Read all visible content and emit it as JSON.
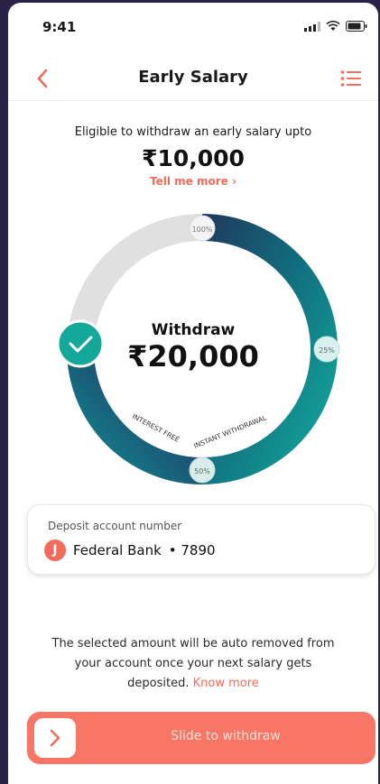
{
  "status_bar": {
    "time": "9:41"
  },
  "header": {
    "title": "Early Salary"
  },
  "eligibility": {
    "text": "Eligible to withdraw an early salary upto",
    "amount": "₹10,000",
    "link": "Tell me more ›"
  },
  "dial": {
    "label_top": "100%",
    "label_right": "25%",
    "label_bottom": "50%",
    "tag_left": "INTEREST FREE",
    "tag_right": "INSTANT WITHDRAWAL",
    "center_label": "Withdraw",
    "center_amount": "₹20,000"
  },
  "deposit": {
    "label": "Deposit account number",
    "bank_logo_letter": "J",
    "bank_name": "Federal Bank",
    "account": "• 7890"
  },
  "notice": {
    "text": "The selected amount will be auto removed from your account once your next salary gets deposited.",
    "link": "Know more"
  },
  "slider": {
    "label": "Slide to withdraw"
  },
  "colors": {
    "accent": "#f26b5b",
    "slider": "#f87665",
    "ring_start": "#1f3b5e",
    "ring_end": "#13a79b",
    "ring_track": "#e0e0e0"
  }
}
